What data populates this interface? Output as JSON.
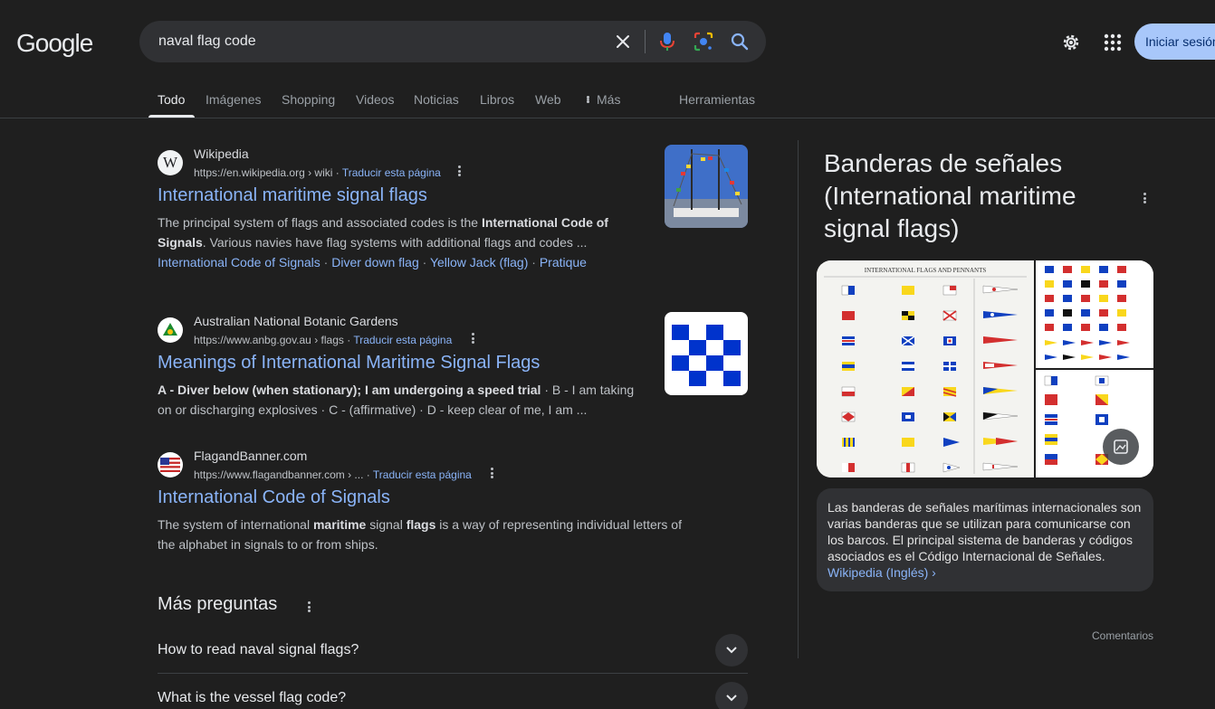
{
  "header": {
    "logo_text": "Google",
    "search_value": "naval flag code",
    "signin_label": "Iniciar sesión"
  },
  "tabs": [
    {
      "label": "Todo"
    },
    {
      "label": "Imágenes"
    },
    {
      "label": "Shopping"
    },
    {
      "label": "Videos"
    },
    {
      "label": "Noticias"
    },
    {
      "label": "Libros"
    },
    {
      "label": "Web"
    },
    {
      "label": "Más"
    }
  ],
  "tools_label": "Herramientas",
  "results": [
    {
      "site": "Wikipedia",
      "url": "https://en.wikipedia.org › wiki",
      "translate": "Traducir esta página",
      "title": "International maritime signal flags",
      "snippet_pre": "The principal system of flags and associated codes is the ",
      "snippet_bold": "International Code of Signals",
      "snippet_post": ". Various navies have flag systems with additional flags and codes ...",
      "sitelinks": [
        "International Code of Signals",
        "Diver down flag",
        "Yellow Jack (flag)",
        "Pratique"
      ]
    },
    {
      "site": "Australian National Botanic Gardens",
      "url": "https://www.anbg.gov.au › flags",
      "translate": "Traducir esta página",
      "title": "Meanings of International Maritime Signal Flags",
      "snippet_bold": "A - Diver below (when stationary); I am undergoing a speed trial",
      "snippet_post": " · B - I am taking on or discharging explosives · C - (affirmative) · D - keep clear of me, I am ..."
    },
    {
      "site": "FlagandBanner.com",
      "url": "https://www.flagandbanner.com › ...",
      "translate": "Traducir esta página",
      "title": "International Code of Signals",
      "snippet_a": "The system of international ",
      "snippet_b": "maritime",
      "snippet_c": " signal ",
      "snippet_d": "flags",
      "snippet_e": " is a way of representing individual letters of the alphabet in signals to or from ships."
    }
  ],
  "more_questions": {
    "title": "Más preguntas",
    "items": [
      "How to read naval signal flags?",
      "What is the vessel flag code?"
    ]
  },
  "knowledge_panel": {
    "title": "Banderas de señales (International maritime signal flags)",
    "image_header_left": "INTERNATIONAL FLAGS AND PENNANTS",
    "description": "Las banderas de señales marítimas internacionales son varias banderas que se utilizan para comunicarse con los barcos. El principal sistema de banderas y códigos asociados es el Código Internacional de Señales.",
    "source_link": "Wikipedia (Inglés)",
    "feedback": "Comentarios"
  }
}
